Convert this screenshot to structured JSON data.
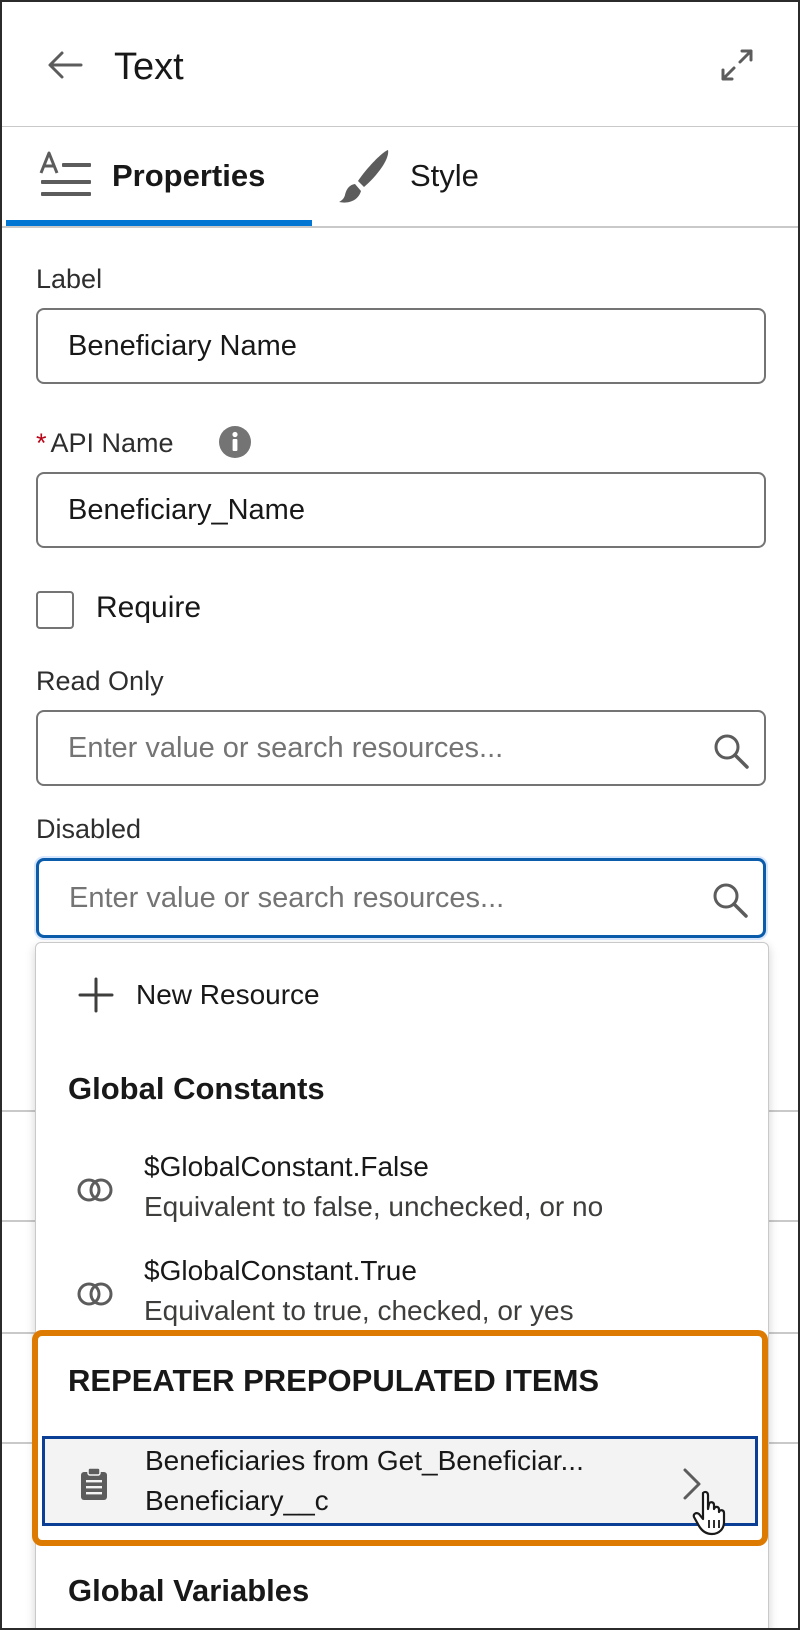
{
  "header": {
    "title": "Text",
    "back_icon": "arrow-left-icon",
    "expand_icon": "expand-icon"
  },
  "tabs": [
    {
      "label": "Properties",
      "icon": "text-properties-icon",
      "active": true
    },
    {
      "label": "Style",
      "icon": "paintbrush-icon",
      "active": false
    }
  ],
  "form": {
    "label_field": {
      "label": "Label",
      "value": "Beneficiary Name"
    },
    "api_name_field": {
      "required_marker": "*",
      "label": "API Name",
      "value": "Beneficiary_Name",
      "info_icon": "info-icon"
    },
    "require_checkbox": {
      "label": "Require",
      "checked": false
    },
    "read_only_field": {
      "label": "Read Only",
      "placeholder": "Enter value or search resources..."
    },
    "disabled_field": {
      "label": "Disabled",
      "placeholder": "Enter value or search resources..."
    }
  },
  "dropdown": {
    "new_resource_label": "New Resource",
    "global_constants_heading": "Global Constants",
    "global_constants": [
      {
        "title": "$GlobalConstant.False",
        "subtitle": "Equivalent to false, unchecked, or no",
        "icon": "constant-icon"
      },
      {
        "title": "$GlobalConstant.True",
        "subtitle": "Equivalent to true, checked, or yes",
        "icon": "constant-icon"
      }
    ],
    "repeater_heading": "REPEATER PREPOPULATED ITEMS",
    "repeater_items": [
      {
        "title": "Beneficiaries from Get_Beneficiar...",
        "subtitle": "Beneficiary__c",
        "icon": "clipboard-list-icon"
      }
    ],
    "global_variables_heading": "Global Variables"
  },
  "colors": {
    "accent": "#0176d3",
    "focus_border": "#0b5cab",
    "highlight": "#dd7a01",
    "required": "#ba0517"
  }
}
